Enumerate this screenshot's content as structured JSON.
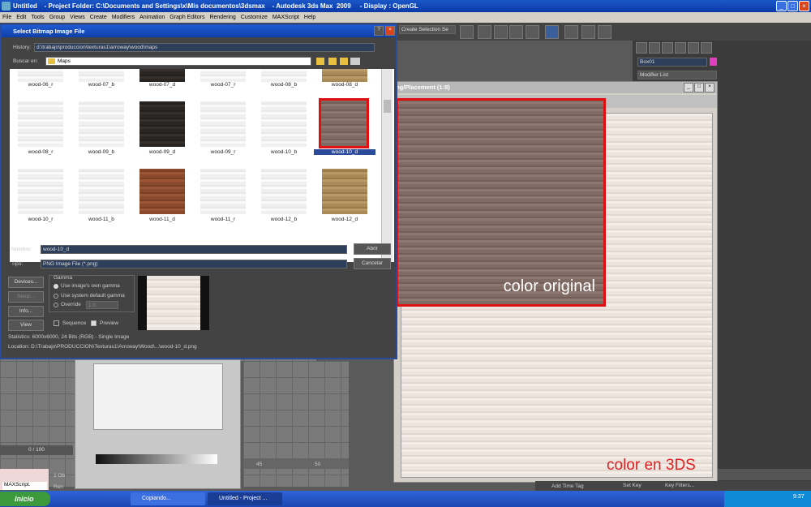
{
  "app": {
    "title": "Untitled    - Project Folder: C:\\Documents and Settings\\x\\Mis documentos\\3dsmax    - Autodesk 3ds Max  2009     - Display : OpenGL"
  },
  "menu": [
    "File",
    "Edit",
    "Tools",
    "Group",
    "Views",
    "Create",
    "Modifiers",
    "Animation",
    "Graph Editors",
    "Rendering",
    "Customize",
    "MAXScript",
    "Help"
  ],
  "toolbar": {
    "selection_set": "Create Selection Se"
  },
  "dialog": {
    "title": "Select Bitmap Image File",
    "history_label": "History:",
    "history_value": "d:\\trabajo\\produccion\\texturas1\\arroway\\wood\\maps",
    "lookin_label": "Buscar en:",
    "lookin_value": "Maps",
    "files": [
      "wood-06_r",
      "wood-07_b",
      "wood-07_d",
      "wood-07_r",
      "wood-08_b",
      "wood-08_d",
      "wood-08_r",
      "wood-09_b",
      "wood-09_d",
      "wood-09_r",
      "wood-10_b",
      "wood-10_d",
      "wood-10_r",
      "wood-11_b",
      "wood-11_d",
      "wood-11_r",
      "wood-12_b",
      "wood-12_d"
    ],
    "name_label": "Nombre:",
    "name_value": "wood-10_d",
    "type_label": "Tipo:",
    "type_value": "PNG Image File (*.png)",
    "open_btn": "Abrir",
    "cancel_btn": "Cancelar",
    "devices_btn": "Devices...",
    "setup_btn": "Setup...",
    "info_btn": "Info...",
    "view_btn": "View",
    "gamma_title": "Gamma",
    "gamma_opt1": "Use image's own gamma",
    "gamma_opt2": "Use system default gamma",
    "gamma_opt3": "Override",
    "override_value": "1.0",
    "sequence": "Sequence",
    "preview": "Preview",
    "statistics": "Statistics:  6000x6000, 24 Bits (RGB) - Single Image",
    "location": "Location:  D:\\Trabajo\\PRODUCCION\\Texturas1\\Arroway\\Wood\\...\\wood-10_d.png"
  },
  "material_window": {
    "title": "ing/Placement (1:8)"
  },
  "annotations": {
    "original": "color original",
    "max": "color en 3DS"
  },
  "cmd": {
    "object_name": "Box01",
    "modifier_list": "Modifier List"
  },
  "timeline": {
    "frame": "0 / 100",
    "ticks": [
      "45",
      "50"
    ]
  },
  "status": {
    "add_time_tag": "Add Time Tag",
    "set_key": "Set Key",
    "key_filters": "Key Filters...",
    "maxscript": "MAXScript.",
    "status_num": "1 Ob",
    "status_ren": "Ren"
  },
  "taskbar": {
    "start": "Inicio",
    "task1": "Copiando...",
    "task2": "Untitled    - Project ...",
    "clock": "9:37"
  }
}
